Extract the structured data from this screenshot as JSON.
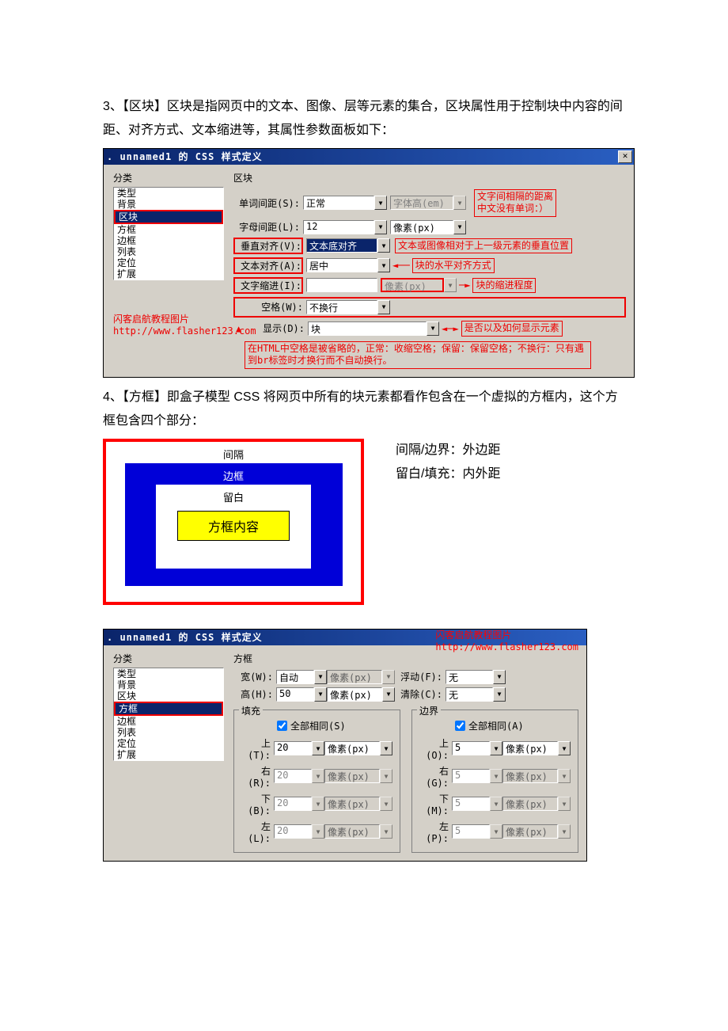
{
  "para3": "3、【区块】区块是指网页中的文本、图像、层等元素的集合，区块属性用于控制块中内容的间距、对齐方式、文本缩进等，其属性参数面板如下：",
  "para4": "4、【方框】即盒子模型 CSS 将网页中所有的块元素都看作包含在一个虚拟的方框内，这个方框包含四个部分：",
  "watermark": {
    "line1": "闪客启航教程图片",
    "line2": "http://www.flasher123.com"
  },
  "dlg1": {
    "title": ". unnamed1 的 CSS 样式定义",
    "cat_label": "分类",
    "section_title": "区块",
    "categories": [
      "类型",
      "背景",
      "区块",
      "方框",
      "边框",
      "列表",
      "定位",
      "扩展"
    ],
    "selected_cat": "区块",
    "rows": {
      "word_spacing": {
        "label": "单词间距(S):",
        "value": "正常",
        "unit": "字体高(em)"
      },
      "letter_spacing": {
        "label": "字母间距(L):",
        "value": "12",
        "unit": "像素(px)"
      },
      "valign": {
        "label": "垂直对齐(V):",
        "value": "文本底对齐"
      },
      "align": {
        "label": "文本对齐(A):",
        "value": "居中"
      },
      "indent": {
        "label": "文字缩进(I):",
        "value": "",
        "unit": "像素(px)"
      },
      "wrap": {
        "label": "空格(W):",
        "value": "不换行"
      },
      "display": {
        "label": "显示(D):",
        "value": "块"
      }
    },
    "hints": {
      "word": "文字间相隔的距离\n中文没有单词：）",
      "valign": "文本或图像相对于上一级元素的垂直位置",
      "align": "块的水平对齐方式",
      "indent": "块的缩进程度",
      "display": "是否以及如何显示元素",
      "note": "在HTML中空格是被省略的，正常：收缩空格；保留：保留空格；不换行：只有遇到br标签时才换行而不自动换行。"
    }
  },
  "boxmodel": {
    "margin": "间隔",
    "border": "边框",
    "padding": "留白",
    "content": "方框内容",
    "side1": "间隔/边界：外边距",
    "side2": "留白/填充：内外距"
  },
  "dlg2": {
    "title": ". unnamed1 的 CSS 样式定义",
    "cat_label": "分类",
    "section_title": "方框",
    "categories": [
      "类型",
      "背景",
      "区块",
      "方框",
      "边框",
      "列表",
      "定位",
      "扩展"
    ],
    "selected_cat": "方框",
    "width": {
      "label": "宽(W):",
      "value": "自动",
      "unit": "像素(px)"
    },
    "height": {
      "label": "高(H):",
      "value": "50",
      "unit": "像素(px)"
    },
    "float": {
      "label": "浮动(F):",
      "value": "无"
    },
    "clear": {
      "label": "清除(C):",
      "value": "无"
    },
    "pad_legend": "填充",
    "mar_legend": "边界",
    "all_same_s": "全部相同(S)",
    "all_same_a": "全部相同(A)",
    "side_labels": {
      "t": "上(T):",
      "r": "右(R):",
      "b": "下(B):",
      "l": "左(L):",
      "to": "上(O):",
      "ro": "右(G):",
      "bo": "下(M):",
      "lo": "左(P):"
    },
    "pad_val": "20",
    "mar_val": "5",
    "unit": "像素(px)"
  }
}
